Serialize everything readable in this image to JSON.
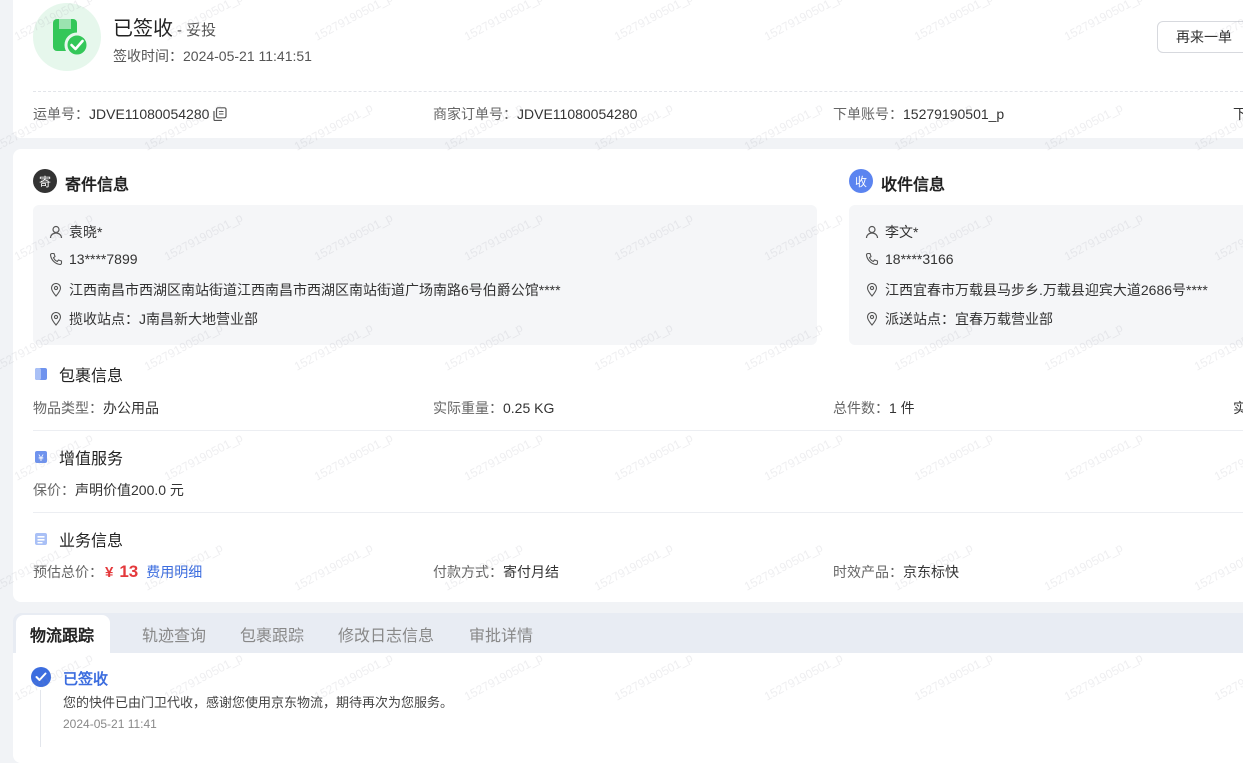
{
  "header": {
    "status": "已签收",
    "status_suffix": "- 妥投",
    "sign_time_label": "签收时间：",
    "sign_time": "2024-05-21 11:41:51",
    "reorder_label": "再来一单",
    "icon": "package-check-icon"
  },
  "order_info": {
    "waybill_label": "运单号：",
    "waybill_no": "JDVE11080054280",
    "merchant_label": "商家订单号：",
    "merchant_no": "JDVE11080054280",
    "account_label": "下单账号：",
    "account": "15279190501_p",
    "cut_label": "下"
  },
  "sender": {
    "badge": "寄",
    "title": "寄件信息",
    "name": "袁晓*",
    "phone": "13****7899",
    "address": "江西南昌市西湖区南站街道江西南昌市西湖区南站街道广场南路6号伯爵公馆****",
    "station": "揽收站点：J南昌新大地营业部"
  },
  "receiver": {
    "badge": "收",
    "title": "收件信息",
    "name": "李文*",
    "phone": "18****3166",
    "address": "江西宜春市万载县马步乡.万载县迎宾大道2686号****",
    "station": "派送站点：宜春万载营业部"
  },
  "package": {
    "title": "包裹信息",
    "type_label": "物品类型：",
    "type_value": "办公用品",
    "weight_label": "实际重量：",
    "weight_value": "0.25 KG",
    "count_label": "总件数：",
    "count_value": "1 件",
    "cut_label": "实"
  },
  "value_added": {
    "title": "增值服务",
    "insured_label": "保价：",
    "insured_value": "声明价值200.0 元"
  },
  "business": {
    "title": "业务信息",
    "estimate_label": "预估总价：",
    "currency": "¥",
    "amount": "13",
    "fee_detail_link": "费用明细",
    "payment_label": "付款方式：",
    "payment_value": "寄付月结",
    "product_label": "时效产品：",
    "product_value": "京东标快"
  },
  "tabs": [
    {
      "label": "物流跟踪"
    },
    {
      "label": "轨迹查询"
    },
    {
      "label": "包裹跟踪"
    },
    {
      "label": "修改日志信息"
    },
    {
      "label": "审批详情"
    }
  ],
  "tracking": {
    "status": "已签收",
    "message": "您的快件已由门卫代收，感谢您使用京东物流，期待再次为您服务。",
    "time": "2024-05-21 11:41"
  },
  "watermark_text": "15279190501_p",
  "colors": {
    "accent_blue": "#3c6ddf",
    "price_red": "#e4393c",
    "green": "#34c759"
  }
}
